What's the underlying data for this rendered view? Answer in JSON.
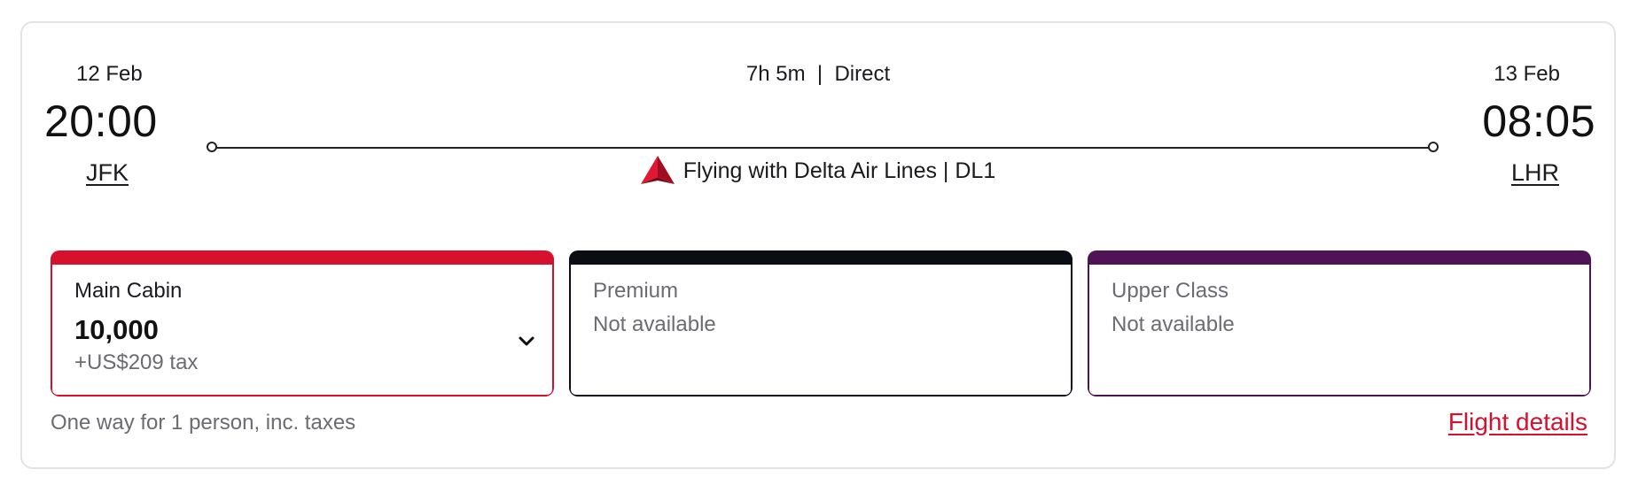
{
  "flight": {
    "departure": {
      "date": "12 Feb",
      "time": "20:00",
      "airport": "JFK"
    },
    "arrival": {
      "date": "13 Feb",
      "time": "08:05",
      "airport": "LHR"
    },
    "duration_text": "7h 5m  |  Direct",
    "carrier_text": "Flying with Delta Air Lines | DL1",
    "carrier_logo_icon": "delta-logo-icon"
  },
  "fares": [
    {
      "name": "Main Cabin",
      "points": "10,000",
      "tax": "+US$209 tax",
      "color": "#d7102e",
      "available": true,
      "expand_icon": "chevron-down-icon"
    },
    {
      "name": "Premium",
      "status": "Not available",
      "color": "#0a0d14",
      "available": false
    },
    {
      "name": "Upper Class",
      "status": "Not available",
      "color": "#4f1356",
      "available": false
    }
  ],
  "footer": {
    "note": "One way for 1 person, inc. taxes",
    "details_link": "Flight details",
    "link_color": "#d7102e"
  }
}
